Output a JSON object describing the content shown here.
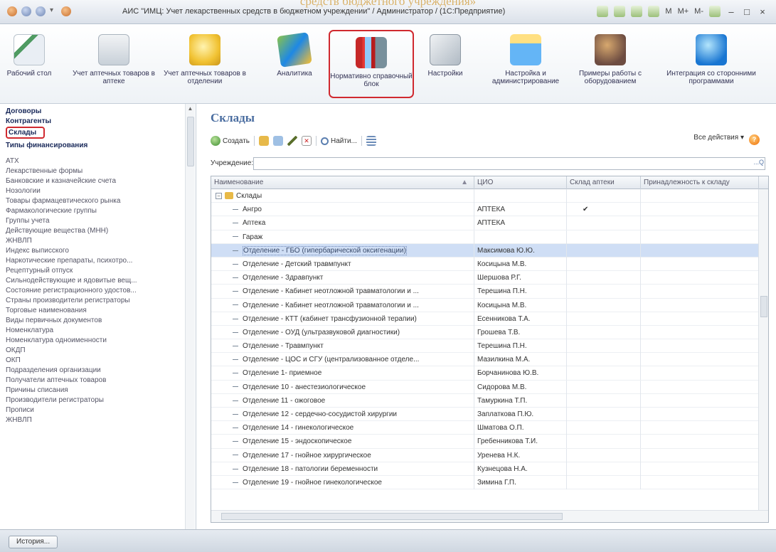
{
  "watermark": "средств бюджетного учреждения»",
  "window": {
    "title": "АИС \"ИМЦ: Учет лекарственных средств в бюджетном учреждении\" / Администратор / (1С:Предприятие)",
    "tools": [
      "M",
      "M+",
      "M-"
    ]
  },
  "sections": [
    {
      "label": "Рабочий стол",
      "icon": "desktop-icon"
    },
    {
      "label": "Учет аптечных товаров в аптеке",
      "icon": "pharmacy-icon"
    },
    {
      "label": "Учет аптечных товаров в отделении",
      "icon": "ward-icon"
    },
    {
      "label": "Аналитика",
      "icon": "analytics-icon"
    },
    {
      "label": "Нормативно справочный блок",
      "icon": "books-icon"
    },
    {
      "label": "Настройки",
      "icon": "settings-icon"
    },
    {
      "label": "Настройка и администрирование",
      "icon": "admin-icon"
    },
    {
      "label": "Примеры работы с оборудованием",
      "icon": "equipment-icon"
    },
    {
      "label": "Интеграция со сторонними программами",
      "icon": "integration-icon"
    }
  ],
  "sidebar": {
    "bold_items": [
      "Договоры",
      "Контрагенты",
      "Склады",
      "Типы финансирования"
    ],
    "items": [
      "АТХ",
      "Лекарственные формы",
      "Банковские и казначейские счета",
      "Нозологии",
      "Товары фармацевтического рынка",
      "Фармакологические группы",
      "Группы учета",
      "Действующие вещества (МНН)",
      "ЖНВЛП",
      "Индекс выписского",
      "Наркотические препараты, психотро...",
      "Рецептурный отпуск",
      "Сильнодействующие и ядовитые вещ...",
      "Состояние регистрационного удостов...",
      "Страны производители регистраторы",
      "Торговые наименования",
      "Виды первичных документов",
      "Номенклатура",
      "Номенклатура одноименности",
      "ОКДП",
      "ОКП",
      "Подразделения организации",
      "Получатели аптечных товаров",
      "Причины списания",
      "Производители регистраторы",
      "Прописи",
      "ЖНВЛП"
    ]
  },
  "content": {
    "title": "Склады",
    "toolbar": {
      "create": "Создать",
      "find": "Найти...",
      "all_actions": "Все действия",
      "help": "?"
    },
    "filter": {
      "label": "Учреждение:",
      "value": "",
      "pick": "...",
      "search": "Q"
    },
    "columns": [
      "Наименование",
      "ЦИО",
      "Склад аптеки",
      "Принадлежность к складу"
    ],
    "group_label": "Склады",
    "rows": [
      {
        "name": "Ангро",
        "cio": "АПТЕКА",
        "pharm": "✔",
        "sel": false
      },
      {
        "name": "Аптека",
        "cio": "АПТЕКА",
        "pharm": "",
        "sel": false
      },
      {
        "name": "Гараж",
        "cio": "",
        "pharm": "",
        "sel": false
      },
      {
        "name": "Отделение - ГБО (гипербарической оксигенации)",
        "cio": "Максимова Ю.Ю.",
        "pharm": "",
        "sel": true
      },
      {
        "name": "Отделение - Детский травмпункт",
        "cio": "Косицына М.В.",
        "pharm": "",
        "sel": false
      },
      {
        "name": "Отделение - Здравпункт",
        "cio": "Шершова Р.Г.",
        "pharm": "",
        "sel": false
      },
      {
        "name": "Отделение - Кабинет неотложной травматологии и ...",
        "cio": "Терешина П.Н.",
        "pharm": "",
        "sel": false
      },
      {
        "name": "Отделение - Кабинет неотложной травматологии и ...",
        "cio": "Косицына М.В.",
        "pharm": "",
        "sel": false
      },
      {
        "name": "Отделение - КТТ (кабинет трансфузионной терапии)",
        "cio": "Есенникова Т.А.",
        "pharm": "",
        "sel": false
      },
      {
        "name": "Отделение - ОУД (ультразвуковой диагностики)",
        "cio": "Грошева Т.В.",
        "pharm": "",
        "sel": false
      },
      {
        "name": "Отделение - Травмпункт",
        "cio": "Терешина П.Н.",
        "pharm": "",
        "sel": false
      },
      {
        "name": "Отделение - ЦОС и СГУ (централизованное отделе...",
        "cio": "Мазилкина М.А.",
        "pharm": "",
        "sel": false
      },
      {
        "name": "Отделение 1- приемное",
        "cio": "Борчанинова Ю.В.",
        "pharm": "",
        "sel": false
      },
      {
        "name": "Отделение 10 - анестезиологическое",
        "cio": "Сидорова М.В.",
        "pharm": "",
        "sel": false
      },
      {
        "name": "Отделение 11 - ожоговое",
        "cio": "Тамуркина Т.П.",
        "pharm": "",
        "sel": false
      },
      {
        "name": "Отделение 12 - сердечно-сосудистой хирургии",
        "cio": "Заплаткова П.Ю.",
        "pharm": "",
        "sel": false
      },
      {
        "name": "Отделение 14 - гинекологическое",
        "cio": "Шматова О.П.",
        "pharm": "",
        "sel": false
      },
      {
        "name": "Отделение 15 - эндоскопическое",
        "cio": "Гребенникова Т.И.",
        "pharm": "",
        "sel": false
      },
      {
        "name": "Отделение 17 - гнойное хирургическое",
        "cio": "Уренева Н.К.",
        "pharm": "",
        "sel": false
      },
      {
        "name": "Отделение 18 - патологии беременности",
        "cio": "Кузнецова Н.А.",
        "pharm": "",
        "sel": false
      },
      {
        "name": "Отделение 19 - гнойное гинекологическое",
        "cio": "Зимина Г.П.",
        "pharm": "",
        "sel": false
      }
    ]
  },
  "status": {
    "history": "История..."
  }
}
